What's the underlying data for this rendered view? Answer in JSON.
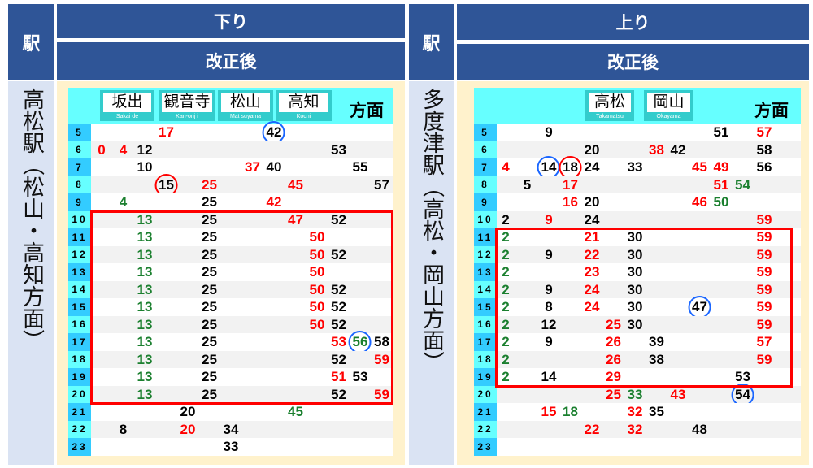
{
  "colors": {
    "red": "#ff0000",
    "green": "#1a7f2e",
    "black": "#000000",
    "blue": "#1a66ff",
    "header": "#2f5597",
    "cyan": "#66ffff",
    "highlight": "#ff0000"
  },
  "panels": [
    {
      "station_col_header": "駅",
      "direction": "下り",
      "revision": "改正後",
      "station": "高松駅（松山・高知方面）",
      "direction_label": "方面",
      "destinations": [
        {
          "name": "坂出",
          "romaji": "Sakai de"
        },
        {
          "name": "観音寺",
          "romaji": "Kan-onj i"
        },
        {
          "name": "松山",
          "romaji": "Mat suyama"
        },
        {
          "name": "高知",
          "romaji": "Kochi"
        }
      ],
      "highlight_hours": [
        "10",
        "20"
      ],
      "rows": [
        {
          "hour": "5",
          "trains": [
            {
              "m": "17",
              "c": "red"
            },
            {
              "m": "42",
              "c": "black",
              "circle": "blue"
            }
          ]
        },
        {
          "hour": "6",
          "trains": [
            {
              "m": "0",
              "c": "red"
            },
            {
              "m": "4",
              "c": "red"
            },
            {
              "m": "12",
              "c": "black"
            },
            {
              "m": "53",
              "c": "black"
            }
          ]
        },
        {
          "hour": "7",
          "trains": [
            {
              "m": "10",
              "c": "black"
            },
            {
              "m": "37",
              "c": "red"
            },
            {
              "m": "40",
              "c": "black"
            },
            {
              "m": "55",
              "c": "black"
            }
          ]
        },
        {
          "hour": "8",
          "trains": [
            {
              "m": "15",
              "c": "black",
              "circle": "red"
            },
            {
              "m": "25",
              "c": "red"
            },
            {
              "m": "45",
              "c": "red"
            },
            {
              "m": "57",
              "c": "black"
            }
          ]
        },
        {
          "hour": "9",
          "trains": [
            {
              "m": "4",
              "c": "green"
            },
            {
              "m": "25",
              "c": "black"
            },
            {
              "m": "42",
              "c": "red"
            }
          ]
        },
        {
          "hour": "10",
          "trains": [
            {
              "m": "13",
              "c": "green"
            },
            {
              "m": "25",
              "c": "black"
            },
            {
              "m": "47",
              "c": "red"
            },
            {
              "m": "52",
              "c": "black"
            }
          ]
        },
        {
          "hour": "11",
          "trains": [
            {
              "m": "13",
              "c": "green"
            },
            {
              "m": "25",
              "c": "black"
            },
            {
              "m": "50",
              "c": "red"
            }
          ]
        },
        {
          "hour": "12",
          "trains": [
            {
              "m": "13",
              "c": "green"
            },
            {
              "m": "25",
              "c": "black"
            },
            {
              "m": "50",
              "c": "red"
            },
            {
              "m": "52",
              "c": "black"
            }
          ]
        },
        {
          "hour": "13",
          "trains": [
            {
              "m": "13",
              "c": "green"
            },
            {
              "m": "25",
              "c": "black"
            },
            {
              "m": "50",
              "c": "red"
            }
          ]
        },
        {
          "hour": "14",
          "trains": [
            {
              "m": "13",
              "c": "green"
            },
            {
              "m": "25",
              "c": "black"
            },
            {
              "m": "50",
              "c": "red"
            },
            {
              "m": "52",
              "c": "black"
            }
          ]
        },
        {
          "hour": "15",
          "trains": [
            {
              "m": "13",
              "c": "green"
            },
            {
              "m": "25",
              "c": "black"
            },
            {
              "m": "50",
              "c": "red"
            },
            {
              "m": "52",
              "c": "black"
            }
          ]
        },
        {
          "hour": "16",
          "trains": [
            {
              "m": "13",
              "c": "green"
            },
            {
              "m": "25",
              "c": "black"
            },
            {
              "m": "50",
              "c": "red"
            },
            {
              "m": "52",
              "c": "black"
            }
          ]
        },
        {
          "hour": "17",
          "trains": [
            {
              "m": "13",
              "c": "green"
            },
            {
              "m": "25",
              "c": "black"
            },
            {
              "m": "53",
              "c": "red"
            },
            {
              "m": "56",
              "c": "green",
              "circle": "blue"
            },
            {
              "m": "58",
              "c": "black"
            }
          ]
        },
        {
          "hour": "18",
          "trains": [
            {
              "m": "13",
              "c": "green"
            },
            {
              "m": "25",
              "c": "black"
            },
            {
              "m": "52",
              "c": "black"
            },
            {
              "m": "59",
              "c": "red"
            }
          ]
        },
        {
          "hour": "19",
          "trains": [
            {
              "m": "13",
              "c": "green"
            },
            {
              "m": "25",
              "c": "black"
            },
            {
              "m": "51",
              "c": "red"
            },
            {
              "m": "53",
              "c": "black"
            }
          ]
        },
        {
          "hour": "20",
          "trains": [
            {
              "m": "13",
              "c": "green"
            },
            {
              "m": "25",
              "c": "black"
            },
            {
              "m": "52",
              "c": "black"
            },
            {
              "m": "59",
              "c": "red"
            }
          ]
        },
        {
          "hour": "21",
          "trains": [
            {
              "m": "20",
              "c": "black"
            },
            {
              "m": "45",
              "c": "green"
            }
          ]
        },
        {
          "hour": "22",
          "trains": [
            {
              "m": "8",
              "c": "black"
            },
            {
              "m": "20",
              "c": "red"
            },
            {
              "m": "34",
              "c": "black"
            }
          ]
        },
        {
          "hour": "23",
          "trains": [
            {
              "m": "33",
              "c": "black"
            }
          ]
        }
      ]
    },
    {
      "station_col_header": "駅",
      "direction": "上り",
      "revision": "改正後",
      "station": "多度津駅（高松・岡山方面）",
      "direction_label": "方面",
      "destinations": [
        {
          "name": "高松",
          "romaji": "Takamatsu"
        },
        {
          "name": "岡山",
          "romaji": "Okayama"
        }
      ],
      "highlight_hours": [
        "11",
        "19"
      ],
      "rows": [
        {
          "hour": "5",
          "trains": [
            {
              "m": "9",
              "c": "black"
            },
            {
              "m": "51",
              "c": "black"
            },
            {
              "m": "57",
              "c": "red"
            }
          ]
        },
        {
          "hour": "6",
          "trains": [
            {
              "m": "20",
              "c": "black"
            },
            {
              "m": "38",
              "c": "red"
            },
            {
              "m": "42",
              "c": "black"
            },
            {
              "m": "58",
              "c": "black"
            }
          ]
        },
        {
          "hour": "7",
          "trains": [
            {
              "m": "4",
              "c": "red"
            },
            {
              "m": "14",
              "c": "black",
              "circle": "blue"
            },
            {
              "m": "18",
              "c": "black",
              "circle": "red"
            },
            {
              "m": "24",
              "c": "black"
            },
            {
              "m": "33",
              "c": "black"
            },
            {
              "m": "45",
              "c": "red"
            },
            {
              "m": "49",
              "c": "red"
            },
            {
              "m": "56",
              "c": "black"
            }
          ]
        },
        {
          "hour": "8",
          "trains": [
            {
              "m": "5",
              "c": "black"
            },
            {
              "m": "17",
              "c": "red"
            },
            {
              "m": "51",
              "c": "red"
            },
            {
              "m": "54",
              "c": "green"
            }
          ]
        },
        {
          "hour": "9",
          "trains": [
            {
              "m": "16",
              "c": "red"
            },
            {
              "m": "20",
              "c": "black"
            },
            {
              "m": "46",
              "c": "red"
            },
            {
              "m": "50",
              "c": "green"
            }
          ]
        },
        {
          "hour": "10",
          "trains": [
            {
              "m": "2",
              "c": "black"
            },
            {
              "m": "9",
              "c": "red"
            },
            {
              "m": "24",
              "c": "black"
            },
            {
              "m": "59",
              "c": "red"
            }
          ]
        },
        {
          "hour": "11",
          "trains": [
            {
              "m": "2",
              "c": "green"
            },
            {
              "m": "21",
              "c": "red"
            },
            {
              "m": "30",
              "c": "black"
            },
            {
              "m": "59",
              "c": "red"
            }
          ]
        },
        {
          "hour": "12",
          "trains": [
            {
              "m": "2",
              "c": "green"
            },
            {
              "m": "9",
              "c": "black"
            },
            {
              "m": "22",
              "c": "red"
            },
            {
              "m": "30",
              "c": "black"
            },
            {
              "m": "59",
              "c": "red"
            }
          ]
        },
        {
          "hour": "13",
          "trains": [
            {
              "m": "2",
              "c": "green"
            },
            {
              "m": "23",
              "c": "red"
            },
            {
              "m": "30",
              "c": "black"
            },
            {
              "m": "59",
              "c": "red"
            }
          ]
        },
        {
          "hour": "14",
          "trains": [
            {
              "m": "2",
              "c": "green"
            },
            {
              "m": "9",
              "c": "black"
            },
            {
              "m": "24",
              "c": "red"
            },
            {
              "m": "30",
              "c": "black"
            },
            {
              "m": "59",
              "c": "red"
            }
          ]
        },
        {
          "hour": "15",
          "trains": [
            {
              "m": "2",
              "c": "green"
            },
            {
              "m": "8",
              "c": "black"
            },
            {
              "m": "24",
              "c": "red"
            },
            {
              "m": "30",
              "c": "black"
            },
            {
              "m": "47",
              "c": "black",
              "circle": "blue"
            },
            {
              "m": "59",
              "c": "red"
            }
          ]
        },
        {
          "hour": "16",
          "trains": [
            {
              "m": "2",
              "c": "green"
            },
            {
              "m": "12",
              "c": "black"
            },
            {
              "m": "25",
              "c": "red"
            },
            {
              "m": "30",
              "c": "black"
            },
            {
              "m": "59",
              "c": "red"
            }
          ]
        },
        {
          "hour": "17",
          "trains": [
            {
              "m": "2",
              "c": "green"
            },
            {
              "m": "9",
              "c": "black"
            },
            {
              "m": "26",
              "c": "red"
            },
            {
              "m": "39",
              "c": "black"
            },
            {
              "m": "57",
              "c": "red"
            }
          ]
        },
        {
          "hour": "18",
          "trains": [
            {
              "m": "2",
              "c": "green"
            },
            {
              "m": "26",
              "c": "red"
            },
            {
              "m": "38",
              "c": "black"
            },
            {
              "m": "59",
              "c": "red"
            }
          ]
        },
        {
          "hour": "19",
          "trains": [
            {
              "m": "2",
              "c": "green"
            },
            {
              "m": "14",
              "c": "black"
            },
            {
              "m": "29",
              "c": "red"
            },
            {
              "m": "53",
              "c": "black"
            }
          ]
        },
        {
          "hour": "20",
          "trains": [
            {
              "m": "25",
              "c": "red"
            },
            {
              "m": "33",
              "c": "green"
            },
            {
              "m": "43",
              "c": "red"
            },
            {
              "m": "54",
              "c": "black",
              "circle": "blue"
            }
          ]
        },
        {
          "hour": "21",
          "trains": [
            {
              "m": "15",
              "c": "red"
            },
            {
              "m": "18",
              "c": "green"
            },
            {
              "m": "32",
              "c": "red"
            },
            {
              "m": "35",
              "c": "black"
            }
          ]
        },
        {
          "hour": "22",
          "trains": [
            {
              "m": "22",
              "c": "red"
            },
            {
              "m": "32",
              "c": "red"
            },
            {
              "m": "48",
              "c": "black"
            }
          ]
        },
        {
          "hour": "23",
          "trains": []
        }
      ]
    }
  ]
}
